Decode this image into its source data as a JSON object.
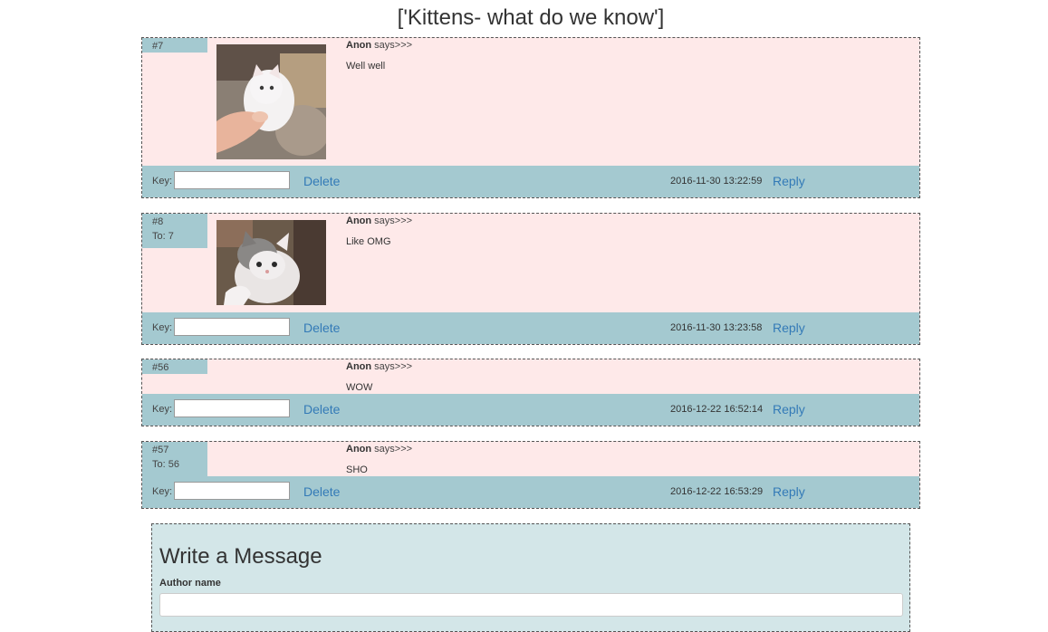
{
  "thread": {
    "title": "['Kittens- what do we know']"
  },
  "posts": [
    {
      "id": "#7",
      "to": "",
      "author": "Anon",
      "says": "says>>>",
      "message": "Well well",
      "key_label": "Key:",
      "delete_label": "Delete",
      "date": "2016-11-30 13:22:59",
      "reply_label": "Reply",
      "image": "white kitten held by hand"
    },
    {
      "id": "#8",
      "to": "To: 7",
      "author": "Anon",
      "says": "says>>>",
      "message": "Like OMG",
      "key_label": "Key:",
      "delete_label": "Delete",
      "date": "2016-11-30 13:23:58",
      "reply_label": "Reply",
      "image": "grey and white kitten"
    },
    {
      "id": "#56",
      "to": "",
      "author": "Anon",
      "says": "says>>>",
      "message": "WOW",
      "key_label": "Key:",
      "delete_label": "Delete",
      "date": "2016-12-22 16:52:14",
      "reply_label": "Reply"
    },
    {
      "id": "#57",
      "to": "To: 56",
      "author": "Anon",
      "says": "says>>>",
      "message": "SHO",
      "key_label": "Key:",
      "delete_label": "Delete",
      "date": "2016-12-22 16:53:29",
      "reply_label": "Reply"
    }
  ],
  "compose": {
    "title": "Write a Message",
    "author_label": "Author name",
    "author_value": ""
  },
  "colors": {
    "post_bg": "#fee9e9",
    "bar_bg": "#a4c9d0",
    "link": "#337ab7",
    "compose_bg": "#d3e6e8"
  }
}
